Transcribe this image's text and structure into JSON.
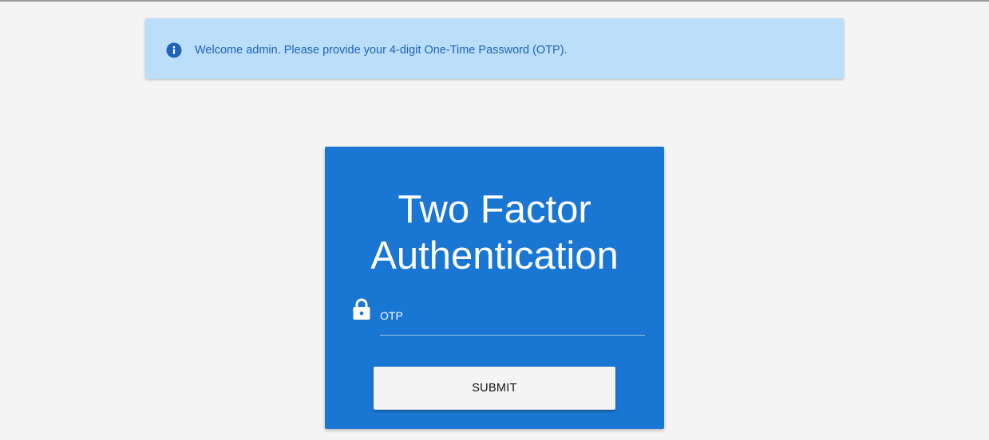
{
  "alert": {
    "icon": "info-icon",
    "message": "Welcome admin. Please provide your 4-digit One-Time Password (OTP).",
    "background_color": "#bbdefb",
    "text_color": "#1e63b8"
  },
  "card": {
    "title": "Two Factor Authentication",
    "background_color": "#1976d2",
    "otp_field": {
      "icon": "lock-icon",
      "label": "OTP",
      "value": ""
    },
    "submit_label": "SUBMIT"
  }
}
